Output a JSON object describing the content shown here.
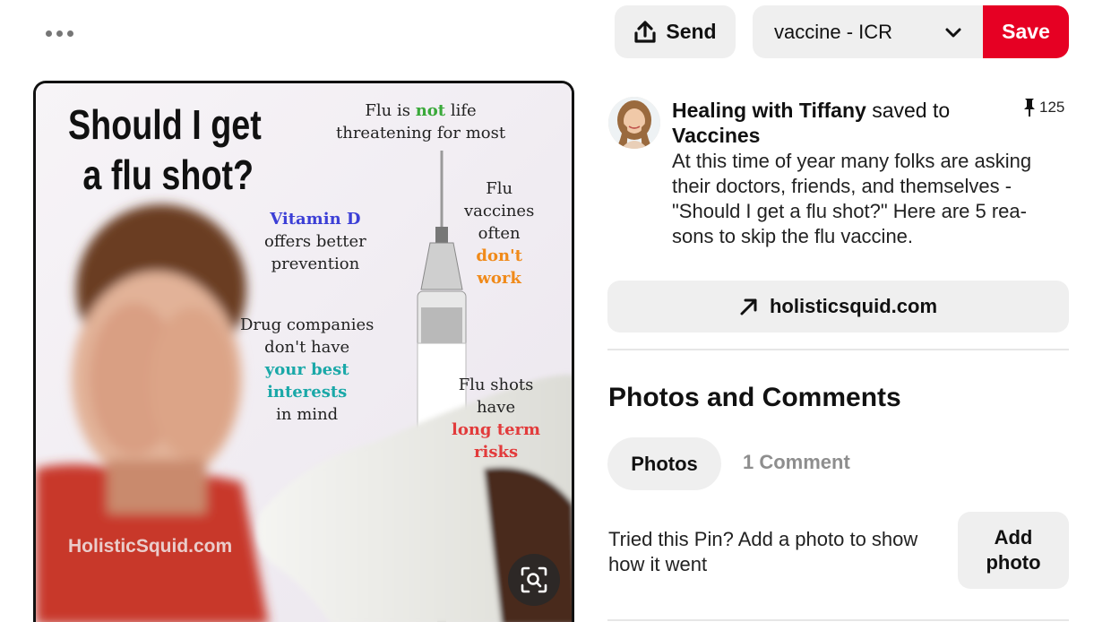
{
  "toolbar": {
    "more_icon": "ellipsis-icon",
    "send_label": "Send",
    "send_icon": "share-upload-icon",
    "board_selected": "vaccine - ICR",
    "board_icon": "chevron-down-icon",
    "save_label": "Save",
    "save_color": "#e60023"
  },
  "pin_image": {
    "headline_line1": "Should I get",
    "headline_line2": "a flu shot?",
    "callout_1_a": "Flu is ",
    "callout_1_b": "not",
    "callout_1_c": " life",
    "callout_1_line2": "threatening for most",
    "callout_2_line1": "Flu",
    "callout_2_line2": "vaccines",
    "callout_2_line3": "often",
    "callout_2_line4": "don't",
    "callout_2_line5": "work",
    "callout_3_line1": "Vitamin D",
    "callout_3_line2": "offers better",
    "callout_3_line3": "prevention",
    "callout_4_line1": "Drug companies",
    "callout_4_line2": "don't have",
    "callout_4_line3": "your best",
    "callout_4_line4": "interests",
    "callout_4_line5": "in mind",
    "callout_5_line1": "Flu shots",
    "callout_5_line2": "have",
    "callout_5_line3": "long term",
    "callout_5_line4": "risks",
    "watermark": "HolisticSquid.com",
    "visual_search_icon": "visual-search-icon",
    "colors": {
      "green": "#3aa93a",
      "blue": "#3c3fd6",
      "orange": "#f08a1a",
      "teal": "#1aa8a8",
      "red": "#e23b3b"
    }
  },
  "pin_info": {
    "author": "Healing with Tiffany",
    "saved_to_text": "saved to",
    "board": "Vaccines",
    "repin_count": "125",
    "repin_icon": "pushpin-icon",
    "description": "At this time of year many folks are asking their doctors, friends, and themselves - \"Should I get a flu shot?\" Here are 5 rea-\nsons to skip the flu vaccine.",
    "link_label": "holisticsquid.com",
    "link_icon": "arrow-up-right-icon"
  },
  "photos_comments": {
    "title": "Photos and Comments",
    "tab_photos": "Photos",
    "tab_comments": "1 Comment",
    "tried_text": "Tried this Pin? Add a photo to show how it went",
    "add_photo_label": "Add\nphoto"
  }
}
